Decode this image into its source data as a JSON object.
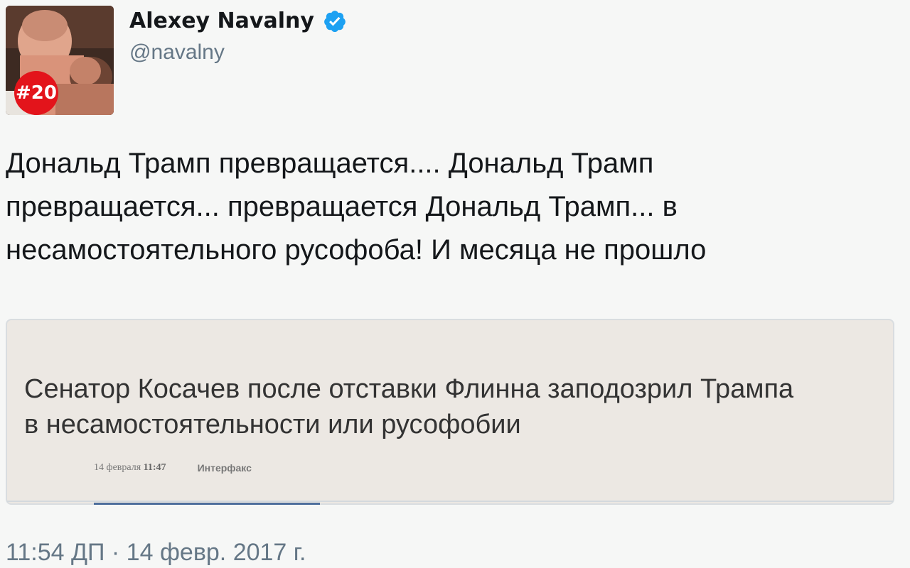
{
  "user": {
    "display_name": "Alexey Navalny",
    "handle": "@navalny",
    "avatar_badge": "#20",
    "verified_icon": "verified-badge-icon"
  },
  "tweet": {
    "line1": "Дональд Трамп превращается.... Дональд Трамп",
    "line2": "превращается... превращается Дональд Трамп... в",
    "line3": "несамостоятельного русофоба! И месяца не прошло",
    "timestamp": "11:54 ДП · 14 февр. 2017 г."
  },
  "card": {
    "headline_line1": "Сенатор Косачев после отставки Флинна заподозрил Трампа",
    "headline_line2": "в несамостоятельности или русофобии",
    "date": "14 февраля",
    "time": "11:47",
    "source": "Интерфакс"
  },
  "colors": {
    "verified": "#1da1f2",
    "badge": "#e3141b",
    "secondary_text": "#657786",
    "primary_text": "#14171a"
  }
}
